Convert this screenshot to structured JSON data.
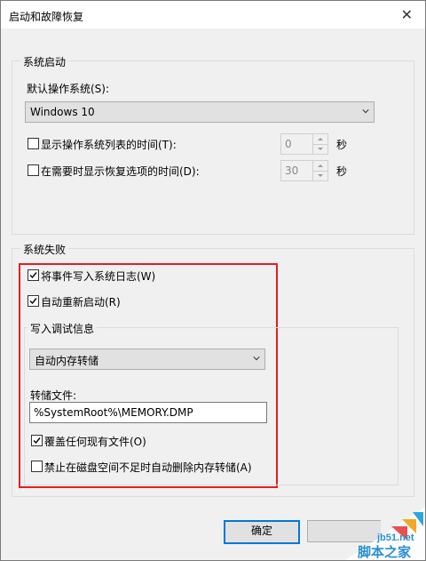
{
  "window": {
    "title": "启动和故障恢复",
    "close_glyph": "✕"
  },
  "system_startup": {
    "legend": "系统启动",
    "default_os_label": "默认操作系统(S):",
    "default_os_value": "Windows 10",
    "show_os_list_label": "显示操作系统列表的时间(T):",
    "show_os_list_checked": false,
    "show_os_list_value": "0",
    "show_recovery_label": "在需要时显示恢复选项的时间(D):",
    "show_recovery_checked": false,
    "show_recovery_value": "30",
    "seconds_unit": "秒"
  },
  "system_failure": {
    "legend": "系统失败",
    "write_event_label": "将事件写入系统日志(W)",
    "write_event_checked": true,
    "auto_restart_label": "自动重新启动(R)",
    "auto_restart_checked": true,
    "debug_info": {
      "legend": "写入调试信息",
      "dump_type_value": "自动内存转储",
      "dump_file_label": "转储文件:",
      "dump_file_value": "%SystemRoot%\\MEMORY.DMP",
      "overwrite_label": "覆盖任何现有文件(O)",
      "overwrite_checked": true,
      "disable_delete_label": "禁止在磁盘空间不足时自动删除内存转储(A)",
      "disable_delete_checked": false
    }
  },
  "buttons": {
    "ok": "确定"
  },
  "watermark": {
    "site": "jb51.net",
    "brand": "脚本之家"
  },
  "colors": {
    "highlight_box": "#e02020",
    "default_button_border": "#0078d7"
  }
}
